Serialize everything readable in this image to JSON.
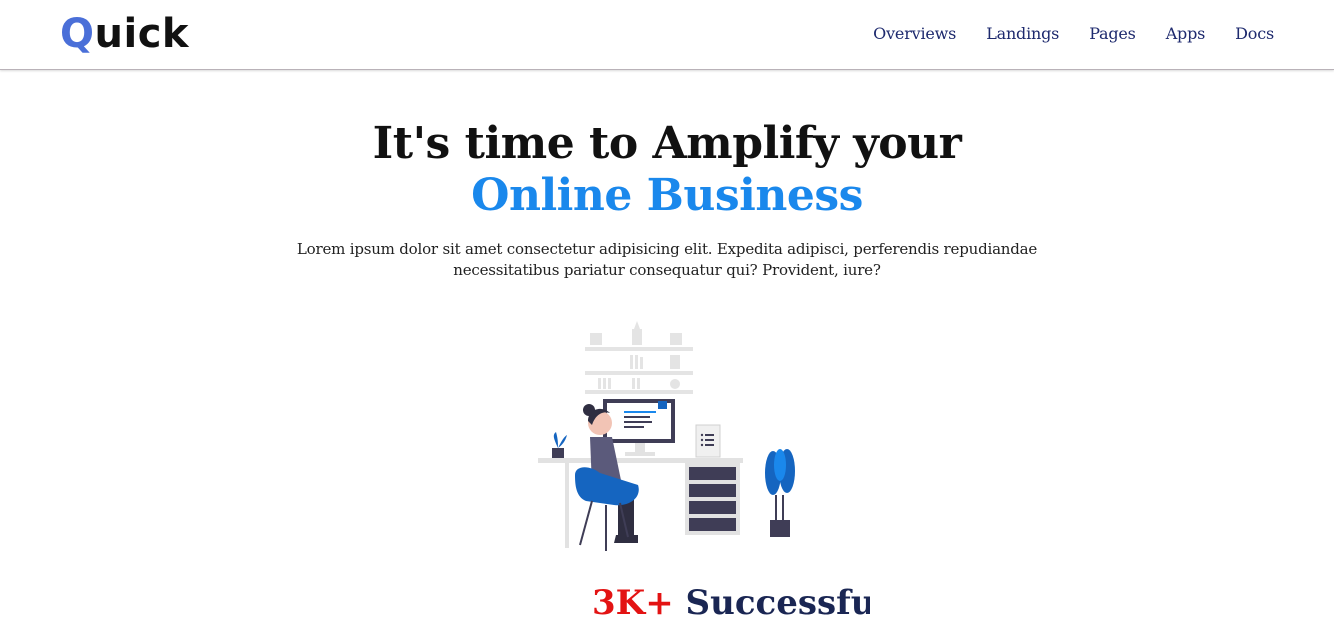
{
  "brand": {
    "first_letter": "Q",
    "rest": "uick"
  },
  "nav": {
    "links": [
      "Overviews",
      "Landings",
      "Pages",
      "Apps",
      "Docs"
    ]
  },
  "hero": {
    "title_line1": "It's time to Amplify your",
    "title_line2": "Online Business",
    "description": "Lorem ipsum dolor sit amet consectetur adipisicing elit. Expedita adipisci, perferendis repudiandae necessitatibus pariatur consequatur qui? Provident, iure?",
    "illustration_icon": "person-working-at-desk-illustration"
  },
  "stats": {
    "number": "3K+",
    "label": "Successfully"
  },
  "colors": {
    "brand_blue": "#4a6fd8",
    "accent_blue": "#1a88ec",
    "nav_text": "#1e2a6e",
    "stat_red": "#e31313",
    "stat_navy": "#1a2653"
  }
}
